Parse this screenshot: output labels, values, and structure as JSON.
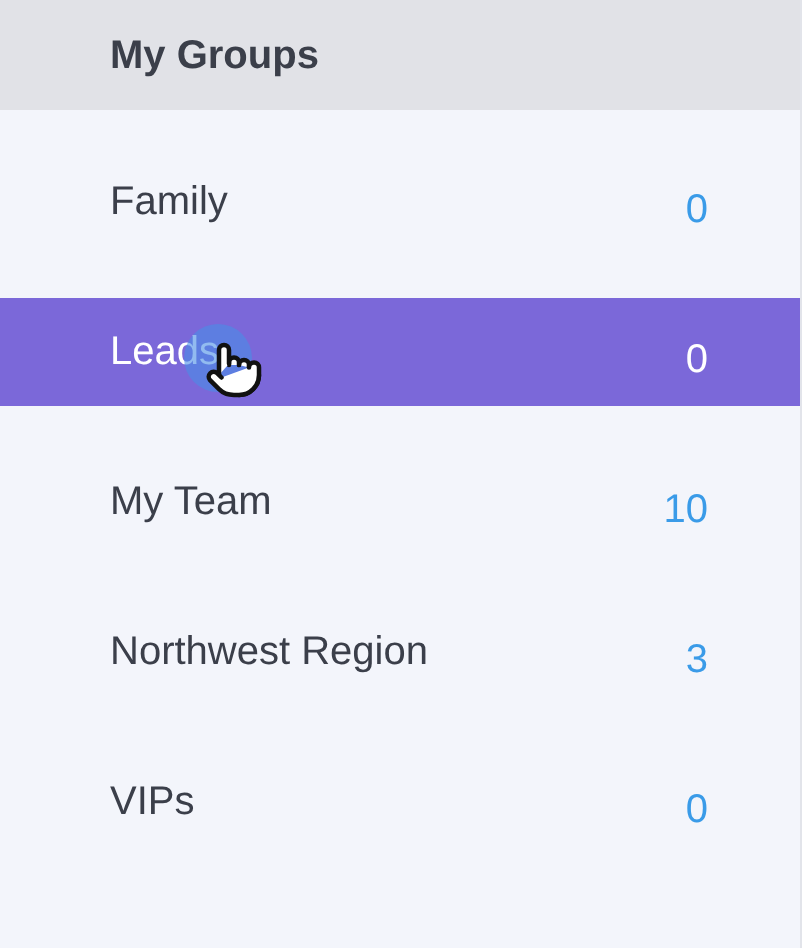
{
  "header": {
    "title": "My Groups"
  },
  "groups": [
    {
      "name": "Family",
      "count": "0",
      "selected": false
    },
    {
      "name": "Leads",
      "count": "0",
      "selected": true
    },
    {
      "name": "My Team",
      "count": "10",
      "selected": false
    },
    {
      "name": "Northwest Region",
      "count": "3",
      "selected": false
    },
    {
      "name": "VIPs",
      "count": "0",
      "selected": false
    }
  ]
}
